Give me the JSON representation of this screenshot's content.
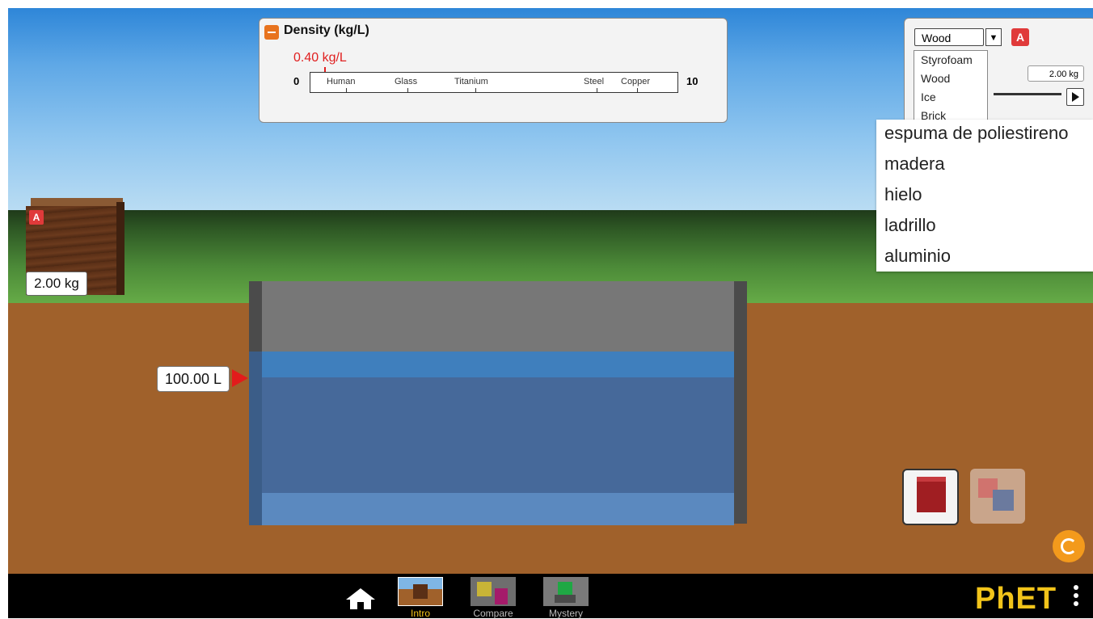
{
  "density_panel": {
    "title": "Density (kg/L)",
    "current_value": "0.40 kg/L",
    "scale_min": "0",
    "scale_max": "10",
    "markers": [
      {
        "label": "Human",
        "value": 1.0
      },
      {
        "label": "Glass",
        "value": 2.6
      },
      {
        "label": "Titanium",
        "value": 4.5
      },
      {
        "label": "Steel",
        "value": 7.8
      },
      {
        "label": "Copper",
        "value": 8.9
      }
    ]
  },
  "block": {
    "tag": "A",
    "mass": "2.00 kg"
  },
  "pool": {
    "volume": "100.00 L"
  },
  "control_panel": {
    "selected_material": "Wood",
    "tag": "A",
    "mass_value": "2.00 kg",
    "materials": [
      "Styrofoam",
      "Wood",
      "Ice",
      "Brick"
    ]
  },
  "translation_overlay": {
    "items": [
      "espuma de poliestireno",
      "madera",
      "hielo",
      "ladrillo",
      "aluminio"
    ]
  },
  "navbar": {
    "screens": [
      "Intro",
      "Compare",
      "Mystery"
    ],
    "active_screen": "Intro",
    "logo": {
      "ph": "PhET",
      "rest": ""
    }
  },
  "colors": {
    "sky": "#5fa8e6",
    "grass": "#4c8a38",
    "ground": "#a0612b",
    "water": "#46699a",
    "accent_red": "#e02020",
    "accent_orange": "#f39a1c",
    "active_nav": "#f2c41a"
  }
}
